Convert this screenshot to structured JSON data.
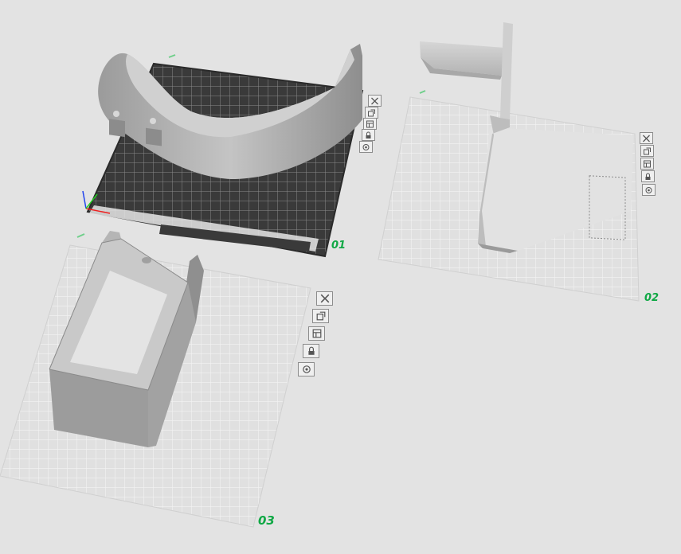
{
  "plates": [
    {
      "id": "plate-01",
      "label": "01"
    },
    {
      "id": "plate-02",
      "label": "02"
    },
    {
      "id": "plate-03",
      "label": "03"
    }
  ],
  "plate_tools": [
    {
      "name": "close",
      "icon": "close-icon"
    },
    {
      "name": "auto-orient",
      "icon": "auto-orient-icon"
    },
    {
      "name": "arrange",
      "icon": "arrange-icon"
    },
    {
      "name": "lock",
      "icon": "lock-icon"
    },
    {
      "name": "settings",
      "icon": "gear-icon"
    }
  ],
  "colors": {
    "background": "#e3e3e3",
    "plate_grid": "#cfcfcf",
    "active_plate": "#3d3d3d",
    "label_accent": "#10a845",
    "model": "#a5a5a5"
  }
}
